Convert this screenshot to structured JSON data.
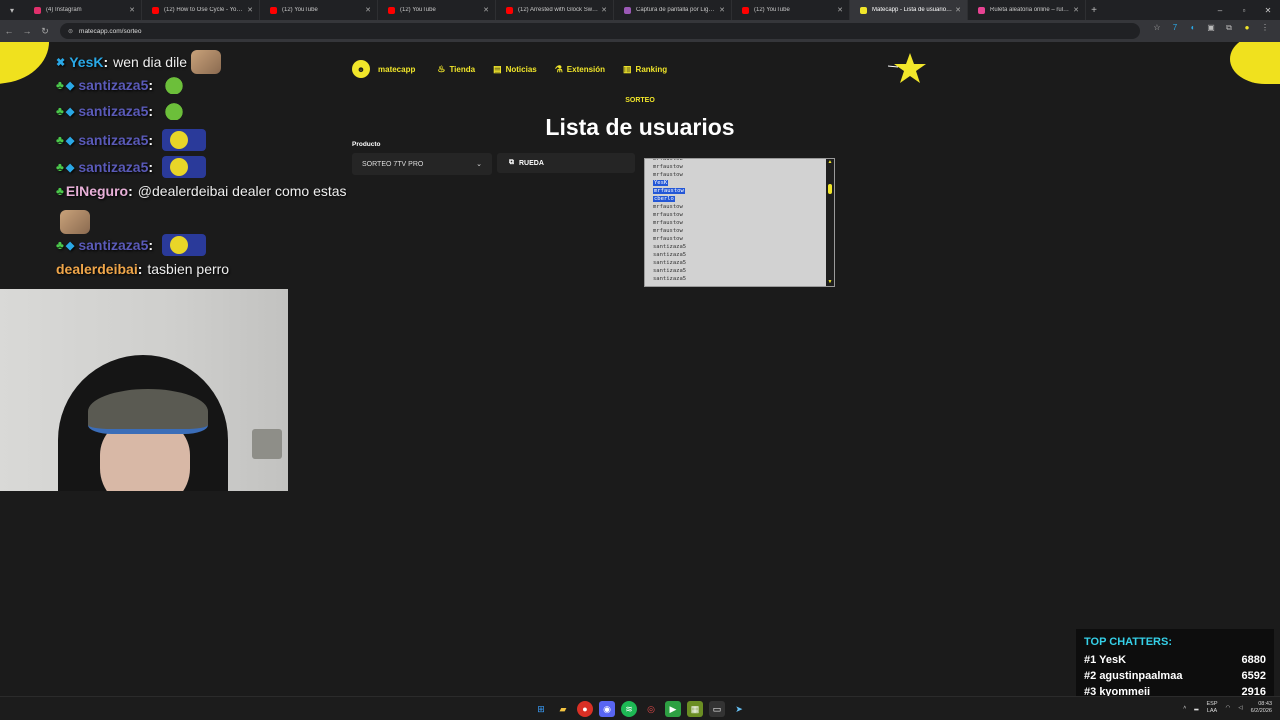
{
  "browser": {
    "tabs": [
      {
        "title": "(4) Instagram",
        "favicon_color": "#e1306c",
        "active": false
      },
      {
        "title": "(12) How to Ose Cycle - YouTube",
        "favicon_color": "#ff0000",
        "active": false
      },
      {
        "title": "(12) YouTube",
        "favicon_color": "#ff0000",
        "active": false
      },
      {
        "title": "(12) YouTube",
        "favicon_color": "#ff0000",
        "active": false
      },
      {
        "title": "(12) Arrested with Glock Switch",
        "favicon_color": "#ff0000",
        "active": false
      },
      {
        "title": "Captura de pantalla por Lightshot",
        "favicon_color": "#9b59b6",
        "active": false
      },
      {
        "title": "(12) YouTube",
        "favicon_color": "#ff0000",
        "active": false
      },
      {
        "title": "Matecapp - Lista de usuarios de",
        "favicon_color": "#f1e62a",
        "active": true
      },
      {
        "title": "Ruleta aleatoria online – ruleta",
        "favicon_color": "#e84393",
        "active": false
      }
    ],
    "url": "matecapp.com/sorteo"
  },
  "site": {
    "brand": "matecapp",
    "nav": [
      {
        "label": "Tienda",
        "icon": "fire-icon"
      },
      {
        "label": "Noticias",
        "icon": "news-icon"
      },
      {
        "label": "Extensión",
        "icon": "flask-icon"
      },
      {
        "label": "Ranking",
        "icon": "chart-icon"
      }
    ],
    "subtitle": "SORTEO",
    "title": "Lista de usuarios",
    "product_label": "Producto",
    "product_value": "SORTEO 7TV PRO",
    "rueda_label": "RUEDA",
    "userlist": [
      {
        "name": "mrfaustow",
        "selected": false
      },
      {
        "name": "mrfaustow",
        "selected": false
      },
      {
        "name": "mrfaustow",
        "selected": false
      },
      {
        "name": "YesK",
        "selected": true
      },
      {
        "name": "mrfaustow",
        "selected": true
      },
      {
        "name": "cberlo",
        "selected": true
      },
      {
        "name": "mrfaustow",
        "selected": false
      },
      {
        "name": "mrfaustow",
        "selected": false
      },
      {
        "name": "mrfaustow",
        "selected": false
      },
      {
        "name": "mrfaustow",
        "selected": false
      },
      {
        "name": "mrfaustow",
        "selected": false
      },
      {
        "name": "santizaza5",
        "selected": false
      },
      {
        "name": "santizaza5",
        "selected": false
      },
      {
        "name": "santizaza5",
        "selected": false
      },
      {
        "name": "santizaza5",
        "selected": false
      },
      {
        "name": "santizaza5",
        "selected": false
      }
    ]
  },
  "chat": [
    {
      "user": "YesK",
      "user_color": "#2aa8e6",
      "msg": "wen dia dile",
      "emote": "cat"
    },
    {
      "user": "santizaza5",
      "user_color": "#5a5ab8",
      "msg": "",
      "emote": "pepe"
    },
    {
      "user": "santizaza5",
      "user_color": "#5a5ab8",
      "msg": "",
      "emote": "pepe"
    },
    {
      "user": "santizaza5",
      "user_color": "#5a5ab8",
      "msg": "",
      "emote": "minion"
    },
    {
      "user": "santizaza5",
      "user_color": "#5a5ab8",
      "msg": "",
      "emote": "minion"
    },
    {
      "user": "ElNeguro",
      "user_color": "#e8b0d8",
      "msg": "@dealerdeibai dealer como estas",
      "emote": ""
    },
    {
      "user": "santizaza5",
      "user_color": "#5a5ab8",
      "msg": "",
      "emote": "minion"
    },
    {
      "user": "dealerdeibai",
      "user_color": "#f0a64a",
      "msg": "tasbien perro",
      "emote": ""
    }
  ],
  "top_chatters": {
    "title": "TOP CHATTERS:",
    "rows": [
      {
        "rank": "#1",
        "name": "YesK",
        "count": "6880"
      },
      {
        "rank": "#2",
        "name": "agustinpaalmaa",
        "count": "6592"
      },
      {
        "rank": "#3",
        "name": "kyommeii",
        "count": "2916"
      }
    ]
  },
  "taskbar": {
    "lang": "ESP",
    "region": "LAA",
    "time": "08:43",
    "date": "6/2/2026"
  }
}
